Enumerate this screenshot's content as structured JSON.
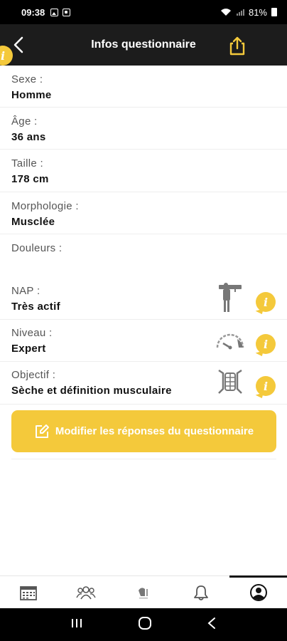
{
  "status_bar": {
    "time": "09:38",
    "battery": "81%"
  },
  "header": {
    "title": "Infos questionnaire"
  },
  "fields": [
    {
      "label": "Sexe :",
      "value": "Homme"
    },
    {
      "label": "Âge :",
      "value": "36 ans"
    },
    {
      "label": "Taille :",
      "value": "178 cm"
    },
    {
      "label": "Morphologie :",
      "value": "Musclée"
    },
    {
      "label": "Douleurs :",
      "value": ""
    },
    {
      "label": "NAP :",
      "value": "Très actif",
      "icon": "active-person-icon"
    },
    {
      "label": "Niveau :",
      "value": "Expert",
      "icon": "gauge-icon"
    },
    {
      "label": "Objectif :",
      "value": "Sèche et définition musculaire",
      "icon": "torso-icon"
    }
  ],
  "edit_button": {
    "label": "Modifier les réponses du questionnaire"
  },
  "info_glyph": "i",
  "colors": {
    "accent": "#f4c93b",
    "header_bg": "#1c1c1c"
  },
  "tabs": [
    {
      "name": "calendar-icon"
    },
    {
      "name": "community-icon"
    },
    {
      "name": "training-icon"
    },
    {
      "name": "bell-icon"
    },
    {
      "name": "profile-icon",
      "active": true
    }
  ]
}
